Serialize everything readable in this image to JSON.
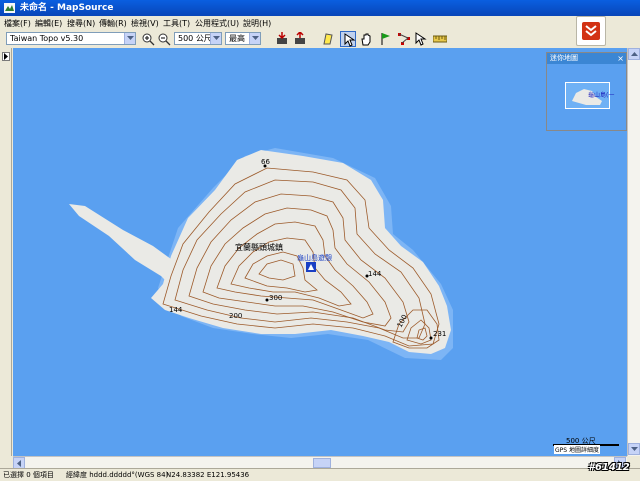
{
  "window": {
    "title": "未命名 - MapSource"
  },
  "menu": [
    {
      "label": "檔案(F)"
    },
    {
      "label": "編輯(E)"
    },
    {
      "label": "搜尋(N)"
    },
    {
      "label": "傳輸(R)"
    },
    {
      "label": "檢視(V)"
    },
    {
      "label": "工具(T)"
    },
    {
      "label": "公用程式(U)"
    },
    {
      "label": "說明(H)"
    }
  ],
  "toolbar": {
    "map_product": "Taiwan Topo v5.30",
    "zoom_scale": "500 公尺",
    "detail_level": "最高"
  },
  "map": {
    "place_label": "宜蘭縣頭城鎮",
    "poi_label": "龜山島遊憩",
    "contour_labels": [
      "66",
      "144",
      "200",
      "144",
      "300",
      "100",
      "231"
    ],
    "colors": {
      "water": "#5aa0f0",
      "land": "#eaeae6",
      "contour": "#9c5a2a"
    }
  },
  "overview": {
    "title": "迷你地圖",
    "close_icon": "close-icon",
    "label": "龜山島(一"
  },
  "scale": {
    "distance": "500 公尺",
    "accuracy": "GPS 地圖詳細度"
  },
  "status": {
    "selection": "已選擇 0 個項目",
    "format": "經緯度 hddd.ddddd°(WGS 84)",
    "coords": "N24.83382 E121.95436"
  },
  "watermark": "#61412"
}
